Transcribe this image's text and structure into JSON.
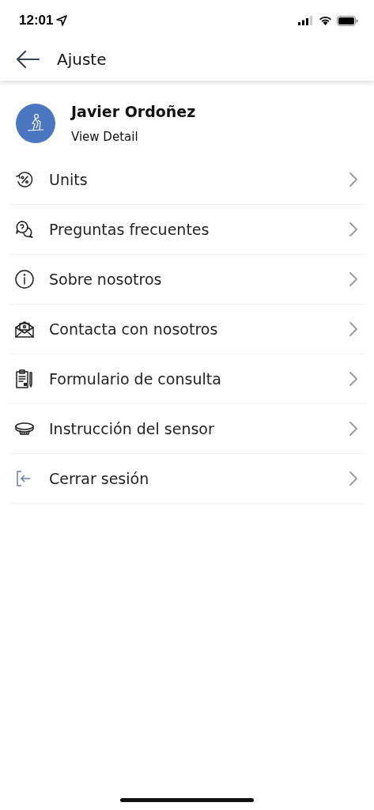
{
  "status_bar": {
    "time": "12:01"
  },
  "header": {
    "title": "Ajuste"
  },
  "profile": {
    "name": "Javier Ordoñez",
    "link": "View Detail"
  },
  "items": [
    {
      "kind": "units",
      "label": "Units"
    },
    {
      "kind": "faq",
      "label": "Preguntas frecuentes"
    },
    {
      "kind": "info",
      "label": "Sobre nosotros"
    },
    {
      "kind": "mail",
      "label": "Contacta con nosotros"
    },
    {
      "kind": "form",
      "label": "Formulario de consulta"
    },
    {
      "kind": "sensor",
      "label": "Instrucción del sensor"
    },
    {
      "kind": "logout",
      "label": "Cerrar sesión"
    }
  ]
}
